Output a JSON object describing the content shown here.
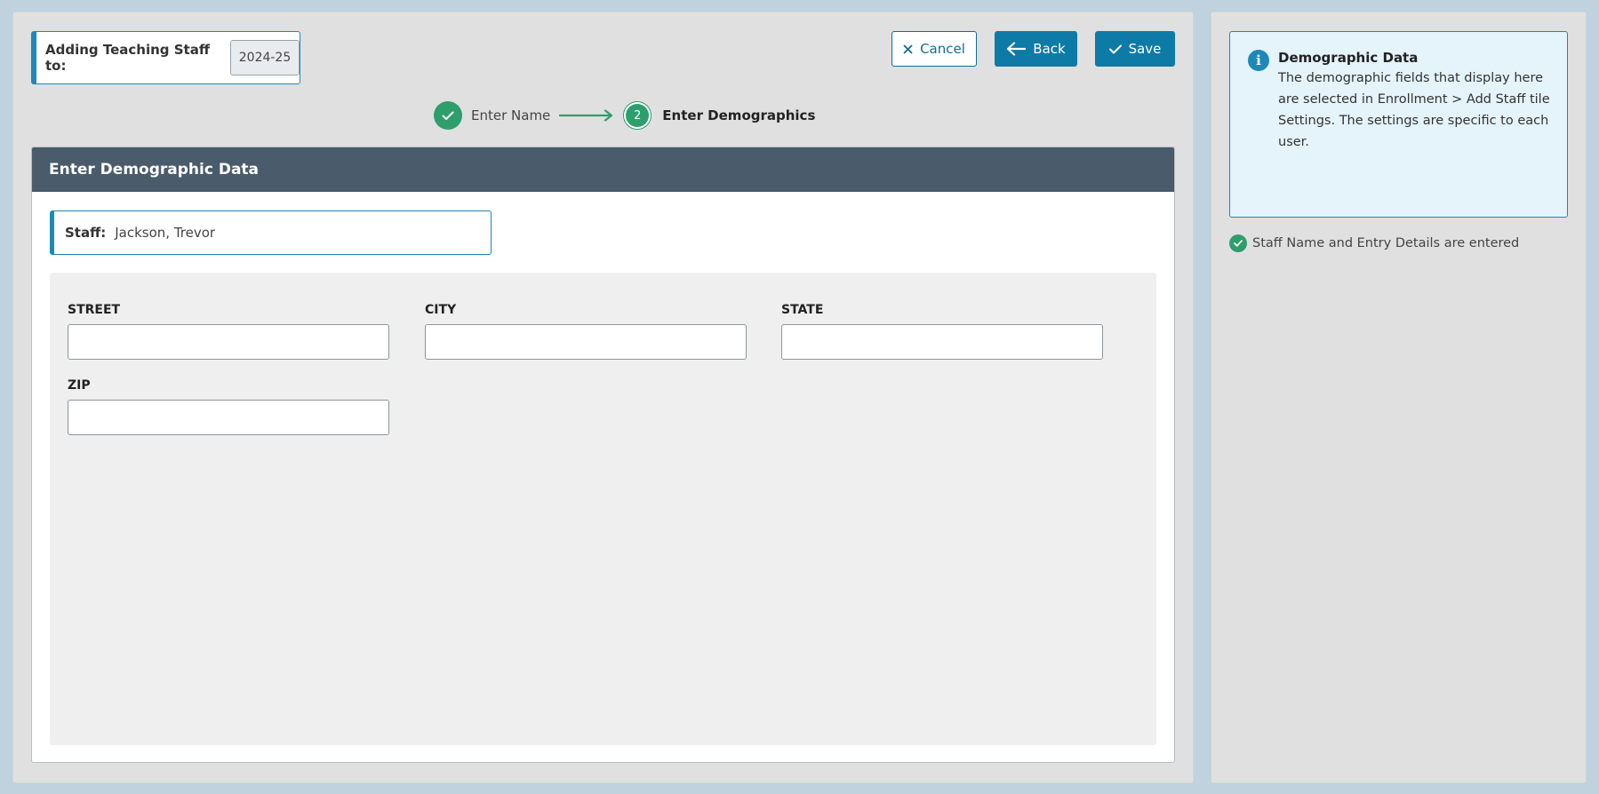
{
  "header": {
    "adding_label": "Adding Teaching Staff to:",
    "year": "2024-25"
  },
  "toolbar": {
    "cancel_label": "Cancel",
    "back_label": "Back",
    "save_label": "Save"
  },
  "stepper": {
    "steps": [
      {
        "number": "1",
        "label": "Enter Name",
        "state": "complete"
      },
      {
        "number": "2",
        "label": "Enter Demographics",
        "state": "current"
      }
    ]
  },
  "card": {
    "title": "Enter Demographic Data",
    "staff_label": "Staff:",
    "staff_value": "Jackson, Trevor",
    "fields": [
      {
        "label": "STREET",
        "value": "",
        "placeholder": ""
      },
      {
        "label": "CITY",
        "value": "",
        "placeholder": ""
      },
      {
        "label": "STATE",
        "value": "",
        "placeholder": ""
      },
      {
        "label": "ZIP",
        "value": "",
        "placeholder": ""
      }
    ]
  },
  "side_panel": {
    "info_icon": "info-icon",
    "info_title": "Demographic Data",
    "info_text": "The demographic fields that display here are selected in Enrollment > Add Staff tile Settings. The settings are specific to each user.",
    "checklist": [
      {
        "text": "Staff Name and Entry Details are entered",
        "status": "complete"
      }
    ]
  },
  "colors": {
    "accent": "#0e7aa6",
    "success": "#2e9e6c",
    "header_bar": "#4a5b6b",
    "info_bg": "#e5f3fb"
  }
}
